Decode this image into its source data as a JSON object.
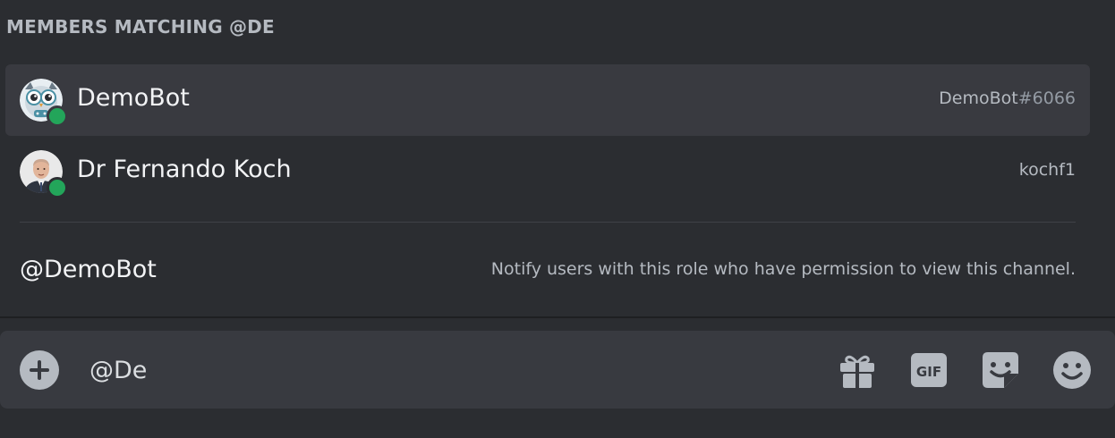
{
  "autocomplete": {
    "header": "MEMBERS MATCHING @DE",
    "members": [
      {
        "display_name": "DemoBot",
        "username": "DemoBot",
        "discriminator": "#6066",
        "avatar": "owl-bot-avatar",
        "status": "online"
      },
      {
        "display_name": "Dr Fernando Koch",
        "username": "kochf1",
        "avatar": "user-photo-avatar",
        "status": "online"
      }
    ],
    "role": {
      "name": "@DemoBot",
      "description": "Notify users with this role who have permission to view this channel."
    }
  },
  "composer": {
    "value": "@De",
    "icons": [
      "plus-icon",
      "gift-icon",
      "gif-icon",
      "sticker-icon",
      "emoji-icon"
    ]
  },
  "colors": {
    "background": "#2b2d31",
    "selected_row": "#393a40",
    "composer": "#383a40",
    "online": "#23a55a",
    "muted_text": "#b5bac1"
  }
}
